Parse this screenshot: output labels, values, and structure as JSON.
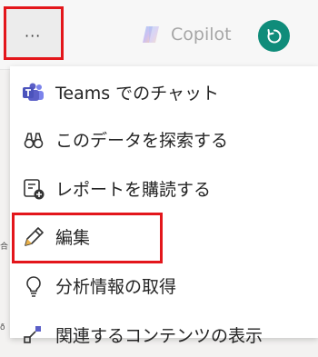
{
  "toolbar": {
    "more_label": "···",
    "copilot_label": "Copilot"
  },
  "menu": {
    "items": [
      {
        "label": "Teams でのチャット",
        "icon": "teams-icon"
      },
      {
        "label": "このデータを探索する",
        "icon": "binoculars-icon"
      },
      {
        "label": "レポートを購読する",
        "icon": "subscribe-icon"
      },
      {
        "label": "編集",
        "icon": "pencil-icon"
      },
      {
        "label": "分析情報の取得",
        "icon": "lightbulb-icon"
      },
      {
        "label": "関連するコンテンツの表示",
        "icon": "related-content-icon"
      }
    ]
  },
  "background": {
    "fragment_1": "合",
    "fragment_2": "ð"
  },
  "colors": {
    "highlight": "#e3161b",
    "teams_purple": "#5b5fc7",
    "refresh_teal": "#0f8c7a"
  }
}
